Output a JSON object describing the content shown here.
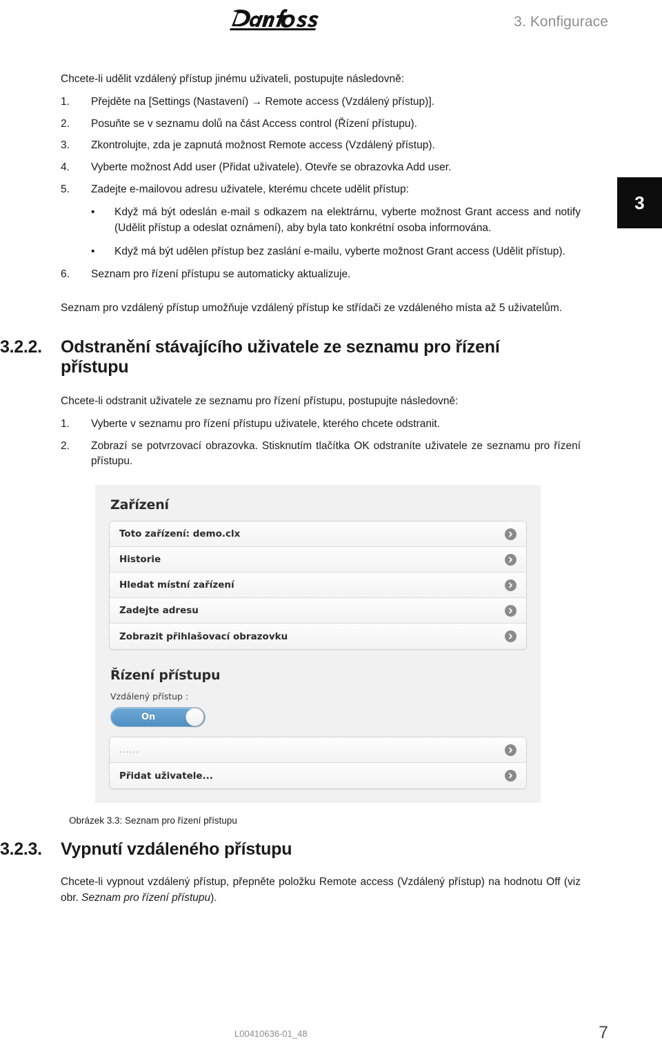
{
  "header": {
    "logo_alt": "Danfoss",
    "chapter": "3. Konfigurace"
  },
  "chapter_tab": {
    "number": "3"
  },
  "section_remote_access": {
    "intro": "Chcete-li udělit vzdálený přístup jinému uživateli, postupujte následovně:",
    "steps": [
      {
        "num": "1.",
        "text": "Přejděte na [Settings (Nastavení) → Remote access (Vzdálený přístup)]."
      },
      {
        "num": "2.",
        "text": "Posuňte se v seznamu dolů na část Access control (Řízení přístupu)."
      },
      {
        "num": "3.",
        "text": "Zkontrolujte, zda je zapnutá možnost Remote access (Vzdálený přístup)."
      },
      {
        "num": "4.",
        "text": "Vyberte možnost Add user (Přidat uživatele). Otevře se obrazovka Add user."
      },
      {
        "num": "5.",
        "text": "Zadejte e-mailovou adresu uživatele, kterému chcete udělit přístup:"
      }
    ],
    "bullets": [
      {
        "marker": "•",
        "text": "Když má být odeslán e-mail s odkazem na elektrárnu, vyberte možnost Grant access and notify (Udělit přístup a odeslat oznámení), aby byla tato konkrétní osoba informována."
      },
      {
        "marker": "•",
        "text": "Když má být udělen přístup bez zaslání e-mailu, vyberte možnost Grant access (Udělit přístup)."
      }
    ],
    "step_last": {
      "num": "6.",
      "text": "Seznam pro řízení přístupu se automaticky aktualizuje."
    },
    "closing_para": "Seznam pro vzdálený přístup umožňuje vzdálený přístup ke střídači ze vzdáleného místa až 5 uživatelům."
  },
  "section_remove_user": {
    "number": "3.2.2.",
    "title": "Odstranění stávajícího uživatele ze seznamu pro řízení přístupu",
    "intro": "Chcete-li odstranit uživatele ze seznamu pro řízení přístupu, postupujte následovně:",
    "steps": [
      {
        "num": "1.",
        "text": "Vyberte v seznamu pro řízení přístupu uživatele, kterého chcete odstranit."
      },
      {
        "num": "2.",
        "text": "Zobrazí se potvrzovací obrazovka. Stisknutím tlačítka OK odstraníte uživatele ze seznamu pro řízení přístupu."
      }
    ]
  },
  "device_screenshot": {
    "device_section_title": "Zařízení",
    "device_rows": [
      {
        "label": "Toto zařízení: demo.clx",
        "icon": "chevron-right-icon"
      },
      {
        "label": "Historie",
        "icon": "chevron-right-icon"
      },
      {
        "label": "Hledat místní zařízení",
        "icon": "chevron-right-icon"
      },
      {
        "label": "Zadejte adresu",
        "icon": "chevron-right-icon"
      },
      {
        "label": "Zobrazit přihlašovací obrazovku",
        "icon": "chevron-right-icon"
      }
    ],
    "access_section_title": "Řízení přístupu",
    "remote_access_label": "Vzdálený přístup :",
    "toggle": {
      "state_label": "On",
      "on_color": "#4e90c4",
      "knob_color": "#ffffff"
    },
    "access_rows": [
      {
        "label": "......",
        "icon": "chevron-right-icon",
        "muted": true
      },
      {
        "label": "Přidat uživatele...",
        "icon": "chevron-right-icon",
        "muted": false
      }
    ]
  },
  "figure": {
    "caption": "Obrázek 3.3: Seznam pro řízení přístupu"
  },
  "section_disable_remote": {
    "number": "3.2.3.",
    "title": "Vypnutí vzdáleného přístupu",
    "body_before_italic": "Chcete-li vypnout vzdálený přístup, přepněte položku Remote access (Vzdálený přístup) na hodnotu Off (viz obr. ",
    "body_italic": "Seznam pro řízení přístupu",
    "body_after_italic": ")."
  },
  "footer": {
    "doc_id": "L00410636-01_48",
    "page_number": "7"
  }
}
